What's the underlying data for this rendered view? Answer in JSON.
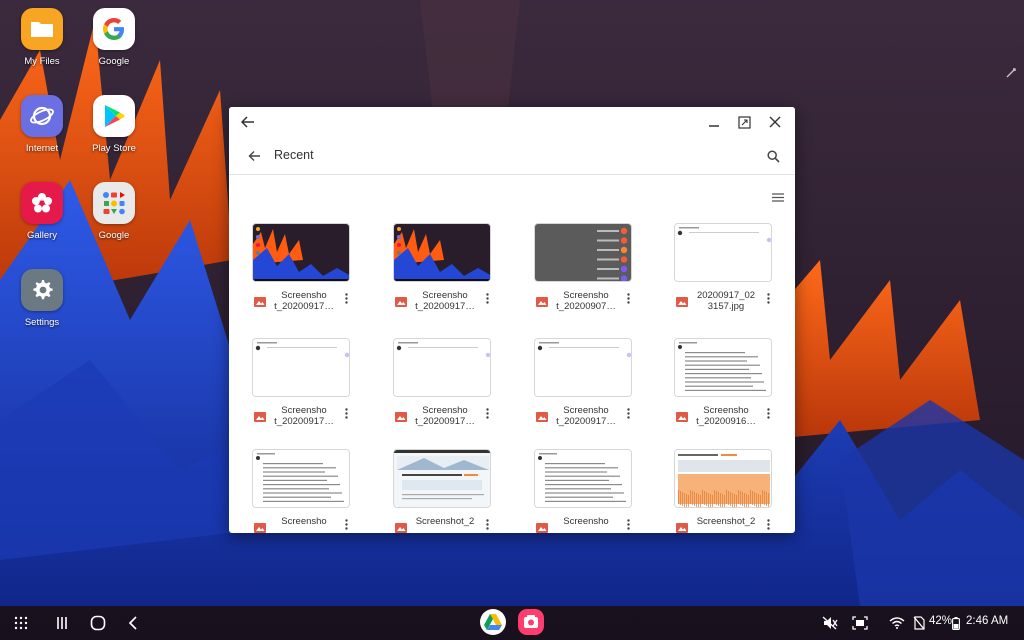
{
  "desktop": {
    "icons": [
      {
        "label": "My Files",
        "icon": "folder-icon"
      },
      {
        "label": "Google",
        "icon": "google-g-icon"
      },
      {
        "label": "Internet",
        "icon": "samsung-internet-icon"
      },
      {
        "label": "Play Store",
        "icon": "play-store-icon"
      },
      {
        "label": "Gallery",
        "icon": "gallery-flower-icon"
      },
      {
        "label": "Google",
        "icon": "google-folder-icon"
      },
      {
        "label": "Settings",
        "icon": "gear-icon"
      }
    ]
  },
  "window": {
    "appbar_title": "Recent",
    "files": [
      {
        "name": "Screenshot_20200917_",
        "short": "Screensho\nt_20200917…",
        "thumb": "wallpaper"
      },
      {
        "name": "Screenshot_20200917_",
        "short": "Screensho\nt_20200917…",
        "thumb": "wallpaper"
      },
      {
        "name": "Screenshot_20200907_",
        "short": "Screensho\nt_20200907…",
        "thumb": "menu-dark"
      },
      {
        "name": "20200917_023157.jpg",
        "short": "20200917_02\n3157.jpg",
        "thumb": "blank-app"
      },
      {
        "name": "Screenshot_20200917_",
        "short": "Screensho\nt_20200917…",
        "thumb": "blank-app"
      },
      {
        "name": "Screenshot_20200917_",
        "short": "Screensho\nt_20200917…",
        "thumb": "blank-app"
      },
      {
        "name": "Screenshot_20200917_",
        "short": "Screensho\nt_20200917…",
        "thumb": "blank-app"
      },
      {
        "name": "Screenshot_20200916_",
        "short": "Screensho\nt_20200916…",
        "thumb": "text-doc"
      },
      {
        "name": "Screenshot",
        "short": "Screensho",
        "thumb": "text-doc"
      },
      {
        "name": "Screenshot_2",
        "short": "Screenshot_2",
        "thumb": "web-page"
      },
      {
        "name": "Screenshot",
        "short": "Screensho",
        "thumb": "text-doc"
      },
      {
        "name": "Screenshot_2",
        "short": "Screenshot_2",
        "thumb": "orange-chart"
      }
    ]
  },
  "status": {
    "battery": "42%",
    "time": "2:46 AM"
  },
  "colors": {
    "accent_file_icon": "#e05a47",
    "window_bg": "#ffffff",
    "taskbar_bg": "#120c16"
  }
}
